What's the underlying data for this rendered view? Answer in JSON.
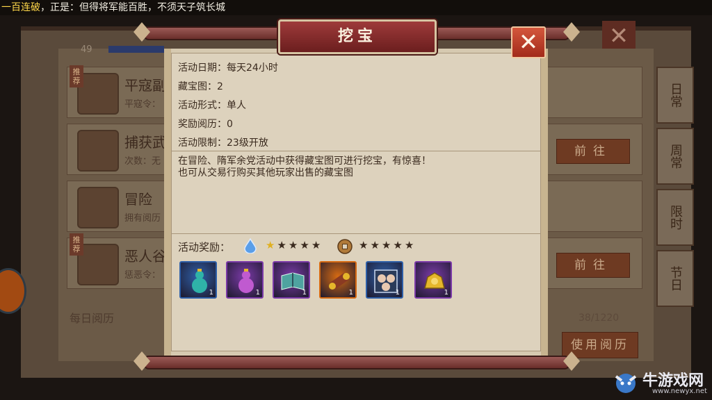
{
  "marquee": {
    "highlight": "一百连破",
    "text": "，正是：但得将军能百胜，不须天子筑长城"
  },
  "background": {
    "level": "49",
    "rows": [
      {
        "title": "平寇副",
        "sub": "平寇令："
      },
      {
        "title": "捕获武",
        "sub": "次数：无"
      },
      {
        "title": "冒险",
        "sub": "拥有阅历"
      },
      {
        "title": "恶人谷",
        "sub": "惩恶令："
      }
    ],
    "recommend_tag": "推荐",
    "go_label": "前往",
    "tabs": [
      "日常",
      "周常",
      "限时",
      "节日"
    ],
    "daily_label": "每日阅历",
    "daily_count": "38/1220",
    "use_label": "使用阅历",
    "close_label": "✕",
    "watermark": {
      "name": "牛游戏网",
      "url": "www.newyx.net"
    }
  },
  "modal": {
    "title": "挖宝",
    "close_label": "✕",
    "info": [
      "活动日期：每天24小时",
      "藏宝图：2",
      "活动形式：单人",
      "奖励阅历：0",
      "活动限制：23级开放"
    ],
    "description": [
      "在冒险、隋军余党活动中获得藏宝图可进行挖宝，有惊喜！",
      "也可从交易行购买其他玩家出售的藏宝图"
    ],
    "reward_label": "活动奖励：",
    "rewards_rating": [
      {
        "icon": "water-drop-icon",
        "lit": 1,
        "total": 5
      },
      {
        "icon": "copper-coin-icon",
        "lit": 0,
        "total": 5
      }
    ],
    "items": [
      {
        "icon": "teal-gourd-icon",
        "qty": "1",
        "bg": "#2e5fa8"
      },
      {
        "icon": "purple-gourd-icon",
        "qty": "1",
        "bg": "#7b3aa8"
      },
      {
        "icon": "book-icon",
        "qty": "1",
        "bg": "#7b3aa8"
      },
      {
        "icon": "scroll-icon",
        "qty": "1",
        "bg": "#d66a12"
      },
      {
        "icon": "portrait-card-icon",
        "qty": "1",
        "bg": "#2e5fa8"
      },
      {
        "icon": "gold-ornament-icon",
        "qty": "1",
        "bg": "#7b3aa8"
      }
    ]
  }
}
